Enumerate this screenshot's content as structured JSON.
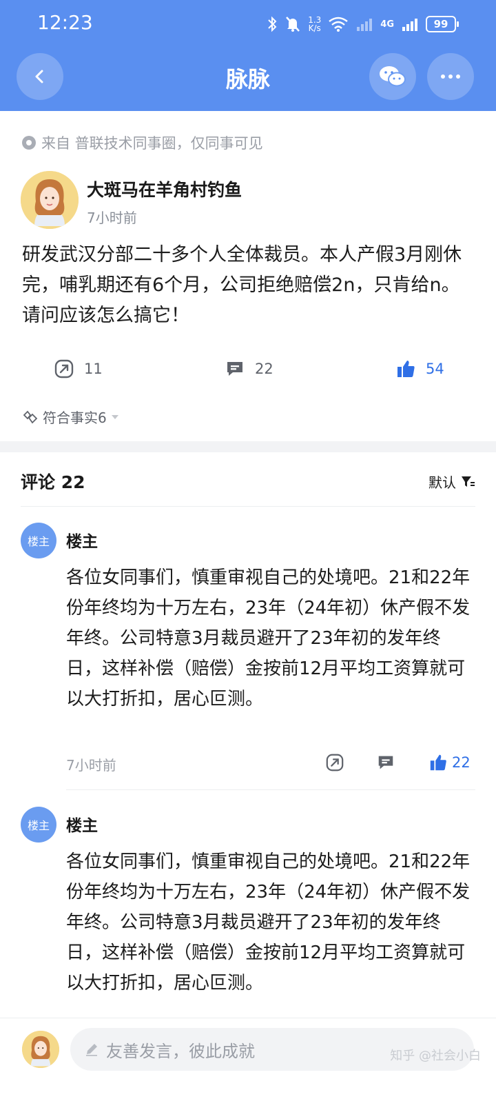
{
  "status_bar": {
    "time": "12:23",
    "net_speed_top": "1.3",
    "net_speed_bottom": "K/s",
    "battery": "99",
    "network": "4G"
  },
  "header": {
    "title": "脉脉"
  },
  "post": {
    "source": "来自 普联技术同事圈，仅同事可见",
    "author_name": "大斑马在羊角村钓鱼",
    "time": "7小时前",
    "body": "研发武汉分部二十多个人全体裁员。本人产假3月刚休完，哺乳期还有6个月，公司拒绝赔偿2n，只肯给n。请问应该怎么搞它！",
    "reposts": "11",
    "comments": "22",
    "likes": "54",
    "fact_tag": "符合事实6"
  },
  "comments_section": {
    "title": "评论 22",
    "sort_label": "默认",
    "items": [
      {
        "avatar_label": "楼主",
        "name": "楼主",
        "body": "各位女同事们，慎重审视自己的处境吧。21和22年份年终均为十万左右，23年（24年初）休产假不发年终。公司特意3月裁员避开了23年初的发年终日，这样补偿（赔偿）金按前12月平均工资算就可以大打折扣，居心叵测。",
        "time": "7小时前",
        "likes": "22"
      },
      {
        "avatar_label": "楼主",
        "name": "楼主",
        "body": "各位女同事们，慎重审视自己的处境吧。21和22年份年终均为十万左右，23年（24年初）休产假不发年终。公司特意3月裁员避开了23年初的发年终日，这样补偿（赔偿）金按前12月平均工资算就可以大打折扣，居心叵测。"
      }
    ]
  },
  "bottom_bar": {
    "input_placeholder": "友善发言，彼此成就",
    "watermark": "知乎 @社会小白"
  },
  "colors": {
    "header": "#5a8ff0",
    "accent": "#2f6fe6"
  }
}
